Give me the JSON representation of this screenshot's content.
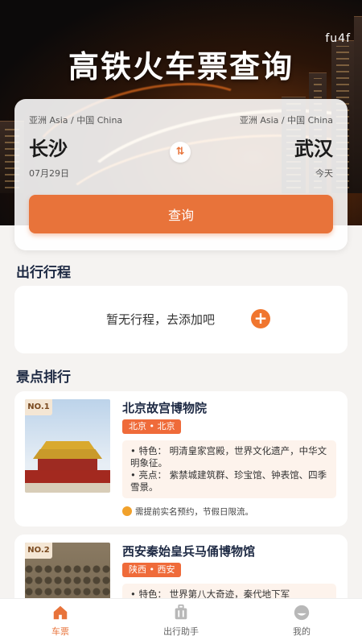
{
  "app_tag": "fu4f",
  "header": {
    "title": "高铁火车票查询"
  },
  "search": {
    "from": {
      "region": "亚洲 Asia / 中国 China",
      "city": "长沙",
      "date": "07月29日"
    },
    "to": {
      "region": "亚洲 Asia / 中国 China",
      "city": "武汉",
      "day": "今天"
    },
    "swap_icon": "⇅",
    "button_label": "查询"
  },
  "trips": {
    "section_title": "出行行程",
    "empty_text": "暂无行程，去添加吧",
    "add_icon": "+"
  },
  "attractions": {
    "section_title": "景点排行",
    "items": [
      {
        "rank": "NO.1",
        "name": "北京故宫博物院",
        "location": "北京 • 北京",
        "features": "•  特色：  明清皇家宫殿，世界文化遗产，中华文明象征。",
        "highlights": "•  亮点：  紫禁城建筑群、珍宝馆、钟表馆、四季雪景。",
        "note": "需提前实名预约，节假日限流。"
      },
      {
        "rank": "NO.2",
        "name": "西安秦始皇兵马俑博物馆",
        "location": "陕西 • 西安",
        "features": "•  特色：  世界第八大奇迹，秦代地下军"
      }
    ]
  },
  "nav": {
    "items": [
      {
        "label": "车票",
        "icon": "home-icon",
        "active": true
      },
      {
        "label": "出行助手",
        "icon": "luggage-icon",
        "active": false
      },
      {
        "label": "我的",
        "icon": "profile-icon",
        "active": false
      }
    ]
  },
  "colors": {
    "accent": "#e8733a",
    "tag": "#ef6b3a",
    "title_navy": "#1e2a44"
  }
}
